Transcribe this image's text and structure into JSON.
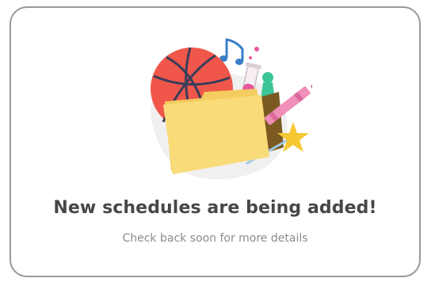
{
  "empty_state": {
    "title": "New schedules are being added!",
    "message": "Check back soon for more details",
    "illustration_icons": [
      "basketball-icon",
      "music-note-icon",
      "test-tube-icon",
      "chess-pawn-icon",
      "crayon-icon",
      "star-wand-icon",
      "folder-icon"
    ]
  },
  "colors": {
    "card_border": "#9e9698",
    "headline_text": "#4a4648",
    "subtext": "#8f8a8c",
    "basketball": "#f0574a",
    "folder": "#fadb7a",
    "star": "#f6c834",
    "crayon": "#f08fb8",
    "chess_pawn": "#3cc596",
    "music_note": "#3a7ec8",
    "test_tube_liquid": "#e8569a"
  }
}
